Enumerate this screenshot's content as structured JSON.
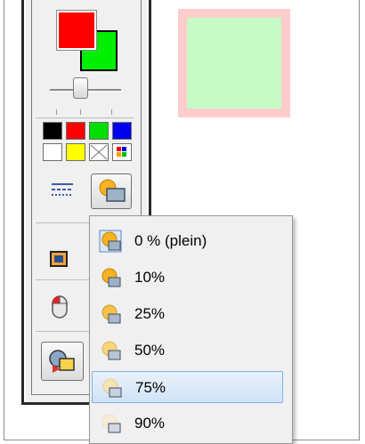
{
  "colors": {
    "foreground": "#ff0000",
    "background": "#00ee00",
    "preview_border": "#ffcccc",
    "preview_fill": "#c6fbc6"
  },
  "palette": [
    {
      "name": "black",
      "color": "#000000"
    },
    {
      "name": "red",
      "color": "#ff0000"
    },
    {
      "name": "green",
      "color": "#00dd00"
    },
    {
      "name": "blue",
      "color": "#0000ee"
    },
    {
      "name": "white",
      "color": "#ffffff"
    },
    {
      "name": "yellow",
      "color": "#ffff00"
    },
    {
      "name": "transparent",
      "color": "none"
    },
    {
      "name": "more-colors",
      "color": "multi"
    }
  ],
  "tools": {
    "line_style_icon": "dashed-lines-icon",
    "transparency_icon": "transparency-icon",
    "frame_icon": "frame-icon",
    "mouse_icon": "mouse-icon",
    "layers_icon": "layers-icon"
  },
  "transparency_menu": {
    "items": [
      {
        "label": "0 % (plein)",
        "opacity": 1.0
      },
      {
        "label": "10%",
        "opacity": 0.9
      },
      {
        "label": "25%",
        "opacity": 0.75
      },
      {
        "label": "50%",
        "opacity": 0.5
      },
      {
        "label": "75%",
        "opacity": 0.25,
        "selected": true
      },
      {
        "label": "90%",
        "opacity": 0.1
      }
    ]
  }
}
